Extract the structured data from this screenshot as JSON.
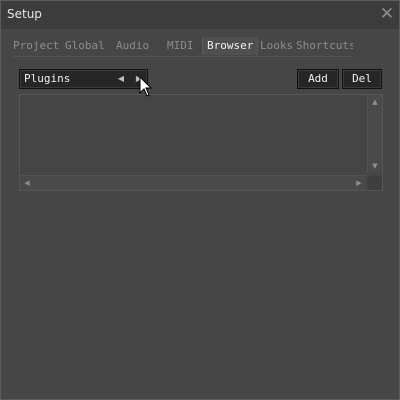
{
  "window": {
    "title": "Setup"
  },
  "tabs": [
    "Project",
    "Global",
    "Audio",
    "MIDI",
    "Browser",
    "Looks",
    "Shortcuts"
  ],
  "active_tab": "Browser",
  "selector": {
    "label": "Plugins"
  },
  "buttons": {
    "add": "Add",
    "del": "Del"
  },
  "icons": {
    "close": "close-icon",
    "left": "triangle-left-icon",
    "right": "triangle-right-icon",
    "up": "triangle-up-icon",
    "down": "triangle-down-icon",
    "cursor": "mouse-pointer-icon"
  },
  "colors": {
    "window_bg": "#464646",
    "titlebar_bg": "#3c3c3c",
    "control_bg": "#262626",
    "text_active": "#f2f2f2",
    "text_inactive": "#8d8d8d"
  }
}
